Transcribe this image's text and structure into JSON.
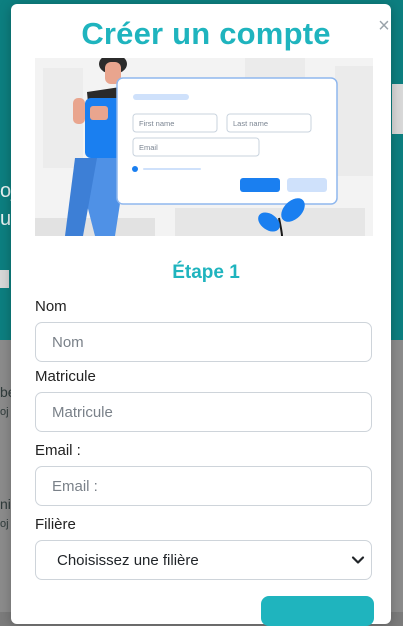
{
  "modal": {
    "title": "Créer un compte",
    "close_symbol": "×",
    "step_title": "Étape 1"
  },
  "illustration": {
    "first_name_text": "First name",
    "last_name_text": "Last name",
    "email_text": "Email"
  },
  "form": {
    "nom_label": "Nom",
    "nom_placeholder": "Nom",
    "matricule_label": "Matricule",
    "matricule_placeholder": "Matricule",
    "email_label": "Email :",
    "email_placeholder": "Email :",
    "filiere_label": "Filière",
    "filiere_selected": "Choisissez une filière"
  },
  "background": {
    "frag1": "oj",
    "frag2": "u",
    "frag3": "be",
    "frag4": "oj",
    "frag5": "ni",
    "frag6": "oj"
  },
  "colors": {
    "accent": "#1fb4be",
    "background_teal": "#0d7f80",
    "illustration_blue": "#1a7ff0"
  },
  "icons": {
    "close": "close-icon",
    "select_chevron": "chevron-down-icon"
  }
}
